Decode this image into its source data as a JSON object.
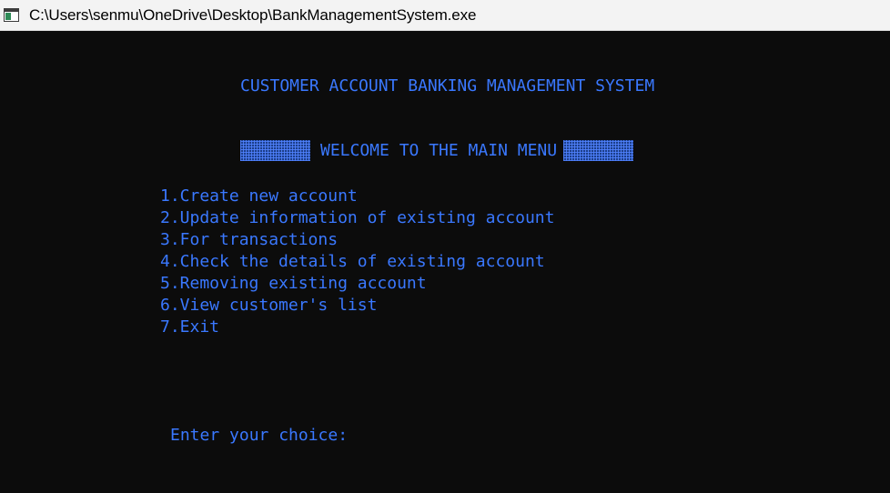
{
  "window": {
    "title": "C:\\Users\\senmu\\OneDrive\\Desktop\\BankManagementSystem.exe"
  },
  "console": {
    "heading": "CUSTOMER ACCOUNT BANKING MANAGEMENT SYSTEM",
    "welcome": "WELCOME TO THE MAIN MENU",
    "menu_items": [
      "1.Create new account",
      "2.Update information of existing account",
      "3.For transactions",
      "4.Check the details of existing account",
      "5.Removing existing account",
      "6.View customer's list",
      "7.Exit"
    ],
    "prompt": "Enter your choice:"
  },
  "colors": {
    "console_background": "#0c0c0c",
    "console_text": "#3a78ff",
    "titlebar_background": "#f3f3f3"
  },
  "icons": {
    "app_icon": "console-window-icon"
  }
}
